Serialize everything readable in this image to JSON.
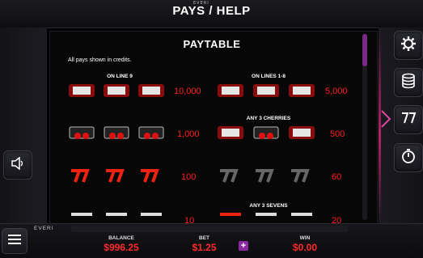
{
  "header": {
    "brand": "EVERI",
    "title": "PAYS / HELP"
  },
  "paytable": {
    "title": "PAYTABLE",
    "note": "All pays shown in credits.",
    "rows": [
      {
        "label_left": "ON LINE 9",
        "pay_left": "10,000",
        "label_right": "ON LINES 1-8",
        "pay_right": "5,000"
      },
      {
        "label_left": "",
        "pay_left": "1,000",
        "label_right": "ANY 3 CHERRIES",
        "pay_right": "500"
      },
      {
        "label_left": "",
        "pay_left": "100",
        "label_right": "",
        "pay_right": "60"
      },
      {
        "label_left": "",
        "pay_left": "10",
        "label_right": "ANY 3 SEVENS",
        "pay_right": "20"
      }
    ]
  },
  "bottom": {
    "logo": "EVERI",
    "balance_label": "BALANCE",
    "balance_value": "$996.25",
    "bet_label": "BET",
    "bet_value": "$1.25",
    "plus": "+",
    "win_label": "WIN",
    "win_value": "$0.00"
  },
  "icons": {
    "settings": "gear-icon",
    "credits": "coins-stack-icon",
    "help": "question-seven-icon",
    "speed": "stopwatch-icon",
    "sound": "speaker-icon",
    "menu": "hamburger-icon"
  },
  "colors": {
    "accent": "#8b2aa0",
    "pay_red": "#ff1f1f",
    "glow": "#b4226e"
  }
}
